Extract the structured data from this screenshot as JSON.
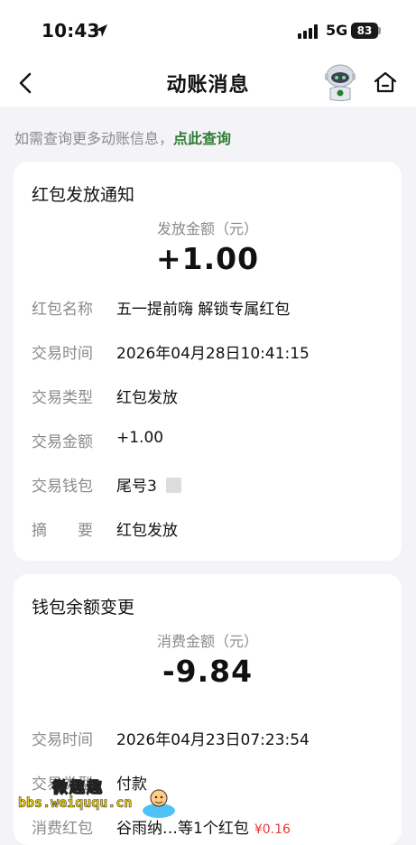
{
  "status_bar": {
    "time": "10:43",
    "network": "5G",
    "battery": "83"
  },
  "nav": {
    "title": "动账消息"
  },
  "notice": {
    "text": "如需查询更多动账信息，",
    "link": "点此查询"
  },
  "cards": [
    {
      "title": "红包发放通知",
      "amount_label": "发放金额（元）",
      "amount": "+1.00",
      "rows": [
        {
          "label": "红包名称",
          "value": "五一提前嗨 解锁专属红包"
        },
        {
          "label": "交易时间",
          "value": "2026年04月28日10:41:15"
        },
        {
          "label": "交易类型",
          "value": "红包发放"
        },
        {
          "label": "交易金额",
          "value": "+1.00"
        },
        {
          "label": "交易钱包",
          "value": "尾号3"
        },
        {
          "label": "摘　　要",
          "value": "红包发放"
        }
      ]
    },
    {
      "title": "钱包余额变更",
      "amount_label": "消费金额（元）",
      "amount": "-9.84",
      "rows": [
        {
          "label": "交易时间",
          "value": "2026年04月23日07:23:54"
        },
        {
          "label": "交易类型",
          "value": "付款"
        },
        {
          "label": "消费红包",
          "value": "谷雨纳…等1个红包",
          "extra": "¥0.16"
        }
      ]
    }
  ],
  "watermark": {
    "title": "微趣趣",
    "url": "bbs.weiququ.cn"
  },
  "colors": {
    "accent_green": "#2e7d32",
    "negative_red": "#e53935",
    "background": "#f4f4f8"
  },
  "icons": [
    "location-arrow-icon",
    "signal-icon",
    "battery-icon",
    "back-icon",
    "robot-avatar-icon",
    "home-icon"
  ]
}
